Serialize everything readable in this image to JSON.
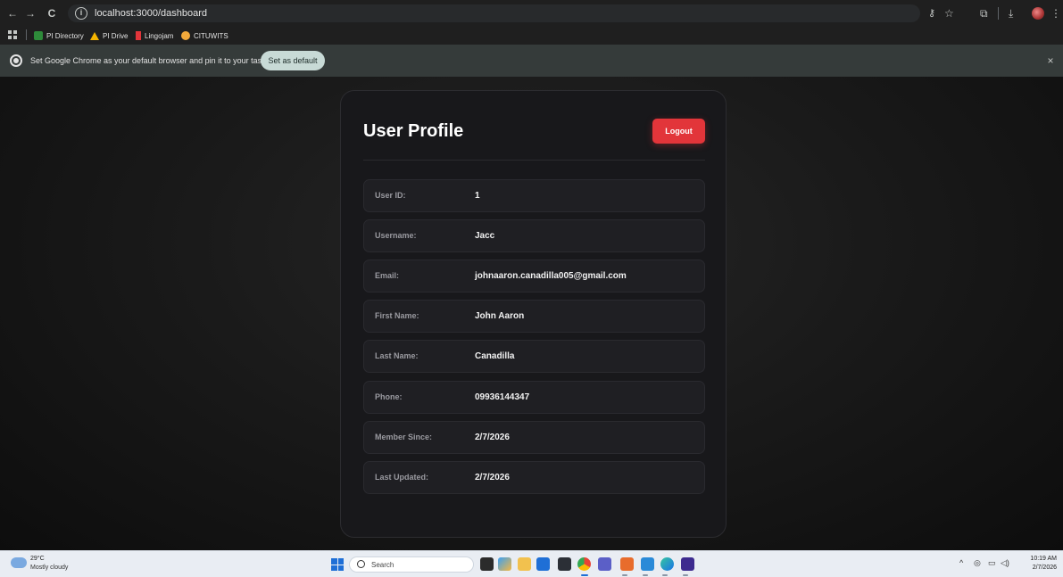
{
  "browser": {
    "url": "localhost:3000/dashboard",
    "nav": {
      "back": "←",
      "forward": "→",
      "reload": "C"
    },
    "bookmarks": [
      {
        "label": "PI Directory",
        "color": "#2e8b3a"
      },
      {
        "label": "PI Drive",
        "color": "#f4b400"
      },
      {
        "label": "Lingojam",
        "color": "#e2353a"
      },
      {
        "label": "CITUWITS",
        "color": "#f2a93b"
      }
    ],
    "infobar": {
      "message": "Set Google Chrome as your default browser and pin it to your taskbar",
      "button": "Set as default",
      "close": "×"
    }
  },
  "profile": {
    "title": "User Profile",
    "logout_label": "Logout",
    "fields": [
      {
        "label": "User ID:",
        "value": "1"
      },
      {
        "label": "Username:",
        "value": "Jacc"
      },
      {
        "label": "Email:",
        "value": "johnaaron.canadilla005@gmail.com"
      },
      {
        "label": "First Name:",
        "value": "John Aaron"
      },
      {
        "label": "Last Name:",
        "value": "Canadilla"
      },
      {
        "label": "Phone:",
        "value": "09936144347"
      },
      {
        "label": "Member Since:",
        "value": "2/7/2026"
      },
      {
        "label": "Last Updated:",
        "value": "2/7/2026"
      }
    ]
  },
  "taskbar": {
    "weather_temp": "29°C",
    "weather_desc": "Mostly cloudy",
    "search_placeholder": "Search",
    "time": "10:19 AM",
    "date": "2/7/2026"
  },
  "colors": {
    "accent": "#e2353a",
    "card_bg": "#18181b",
    "row_bg": "#1f1f23"
  }
}
